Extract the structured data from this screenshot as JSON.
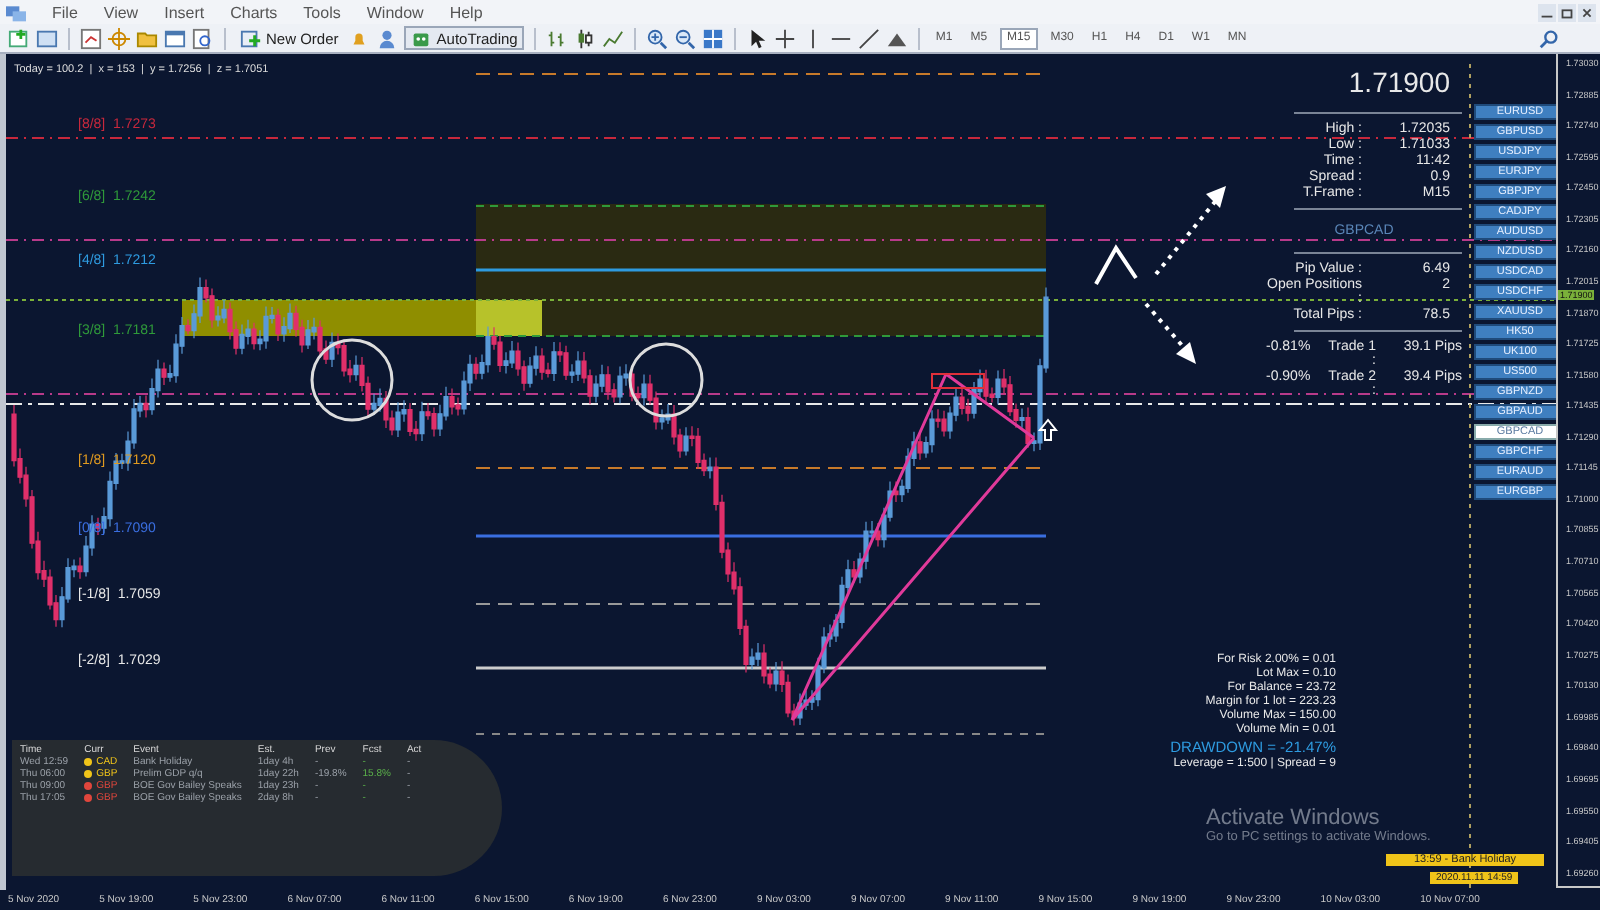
{
  "menu": [
    "File",
    "View",
    "Insert",
    "Charts",
    "Tools",
    "Window",
    "Help"
  ],
  "toolbar": {
    "new_order": "New Order",
    "auto_trading": "AutoTrading",
    "timeframes": [
      {
        "label": "M1",
        "selected": false
      },
      {
        "label": "M5",
        "selected": false
      },
      {
        "label": "M15",
        "selected": true
      },
      {
        "label": "M30",
        "selected": false
      },
      {
        "label": "H1",
        "selected": false
      },
      {
        "label": "H4",
        "selected": false
      },
      {
        "label": "D1",
        "selected": false
      },
      {
        "label": "W1",
        "selected": false
      },
      {
        "label": "MN",
        "selected": false
      }
    ]
  },
  "status": "Today = 100.2  |  x = 153  |  y = 1.7256  |  z = 1.7051",
  "levels": [
    {
      "label": "[8/8]",
      "price": "1.7273",
      "color": "#c8283c"
    },
    {
      "label": "[6/8]",
      "price": "1.7242",
      "color": "#2f9a3a"
    },
    {
      "label": "[4/8]",
      "price": "1.7212",
      "color": "#2e9be0"
    },
    {
      "label": "[3/8]",
      "price": "1.7181",
      "color": "#2f9a3a"
    },
    {
      "label": "[1/8]",
      "price": "1.7120",
      "color": "#e09a20"
    },
    {
      "label": "[0/8]",
      "price": "1.7090",
      "color": "#3a6ee0"
    },
    {
      "label": "[-1/8]",
      "price": "1.7059",
      "color": "#e8e8e8"
    },
    {
      "label": "[-2/8]",
      "price": "1.7029",
      "color": "#e8e8e8"
    }
  ],
  "info": {
    "price": "1.71900",
    "stats": [
      {
        "label": "High :",
        "value": "1.72035"
      },
      {
        "label": "Low :",
        "value": "1.71033"
      },
      {
        "label": "Time :",
        "value": "11:42"
      },
      {
        "label": "Spread :",
        "value": "0.9"
      },
      {
        "label": "T.Frame :",
        "value": "M15"
      }
    ],
    "symbol": "GBPCAD",
    "position": [
      {
        "label": "Pip Value :",
        "value": "6.49"
      },
      {
        "label": "Open Positions :",
        "value": "2"
      },
      {
        "label": "Total Pips :",
        "value": "78.5"
      }
    ],
    "trades": [
      {
        "pct": "-0.81%",
        "label": "Trade 1 :",
        "value": "39.1 Pips"
      },
      {
        "pct": "-0.90%",
        "label": "Trade 2 :",
        "value": "39.4 Pips"
      }
    ]
  },
  "symbols": [
    {
      "label": "EURUSD",
      "selected": false
    },
    {
      "label": "GBPUSD",
      "selected": false
    },
    {
      "label": "USDJPY",
      "selected": false
    },
    {
      "label": "EURJPY",
      "selected": false
    },
    {
      "label": "GBPJPY",
      "selected": false
    },
    {
      "label": "CADJPY",
      "selected": false
    },
    {
      "label": "AUDUSD",
      "selected": false
    },
    {
      "label": "NZDUSD",
      "selected": false
    },
    {
      "label": "USDCAD",
      "selected": false
    },
    {
      "label": "USDCHF",
      "selected": false
    },
    {
      "label": "XAUUSD",
      "selected": false
    },
    {
      "label": "HK50",
      "selected": false
    },
    {
      "label": "UK100",
      "selected": false
    },
    {
      "label": "US500",
      "selected": false
    },
    {
      "label": "GBPNZD",
      "selected": false
    },
    {
      "label": "GBPAUD",
      "selected": false
    },
    {
      "label": "GBPCAD",
      "selected": true
    },
    {
      "label": "GBPCHF",
      "selected": false
    },
    {
      "label": "EURAUD",
      "selected": false
    },
    {
      "label": "EURGBP",
      "selected": false
    }
  ],
  "news": {
    "columns": [
      "Time",
      "Curr",
      "Event",
      "Est.",
      "Prev",
      "Fcst",
      "Act"
    ],
    "rows": [
      {
        "time": "Wed 12:59",
        "currency": "CAD",
        "color": "#f0c419",
        "event": "Bank Holiday",
        "eta": "1day 4h",
        "prev": "-",
        "fcst": "-",
        "act": "-"
      },
      {
        "time": "Thu 06:00",
        "currency": "GBP",
        "color": "#f0c419",
        "event": "Prelim GDP q/q",
        "eta": "1day 22h",
        "prev": "-19.8%",
        "fcst": "15.8%",
        "act": "-"
      },
      {
        "time": "Thu 09:00",
        "currency": "GBP",
        "color": "#e0463c",
        "event": "BOE Gov Bailey Speaks",
        "eta": "1day 23h",
        "prev": "-",
        "fcst": "-",
        "act": "-"
      },
      {
        "time": "Thu 17:05",
        "currency": "GBP",
        "color": "#e0463c",
        "event": "BOE Gov Bailey Speaks",
        "eta": "2day 8h",
        "prev": "-",
        "fcst": "-",
        "act": "-"
      }
    ]
  },
  "risk": [
    {
      "kind": "plain",
      "text": "For Risk 2.00% = 0.01"
    },
    {
      "kind": "plain",
      "text": "Lot Max = 0.10"
    },
    {
      "kind": "plain",
      "text": "For Balance = 23.72"
    },
    {
      "kind": "plain",
      "text": "Margin for 1 lot = 223.23"
    },
    {
      "kind": "plain",
      "text": "Volume Max = 150.00"
    },
    {
      "kind": "plain",
      "text": "Volume Min = 0.01"
    },
    {
      "kind": "alert",
      "text": "DRAWDOWN = -21.47%"
    },
    {
      "kind": "plain",
      "text": "Leverage = 1:500 | Spread = 9"
    }
  ],
  "event_tag": "13:59 - Bank Holiday",
  "time_tag": "2020.11.11 14:59",
  "current_price_tag": "1.71900",
  "price_axis": [
    "1.73030",
    "1.72885",
    "1.72740",
    "1.72595",
    "1.72450",
    "1.72305",
    "1.72160",
    "1.72015",
    "1.71870",
    "1.71725",
    "1.71580",
    "1.71435",
    "1.71290",
    "1.71145",
    "1.71000",
    "1.70855",
    "1.70710",
    "1.70565",
    "1.70420",
    "1.70275",
    "1.70130",
    "1.69985",
    "1.69840",
    "1.69695",
    "1.69550",
    "1.69405",
    "1.69260"
  ],
  "time_axis": [
    "5 Nov 2020",
    "5 Nov 19:00",
    "5 Nov 23:00",
    "6 Nov 07:00",
    "6 Nov 11:00",
    "6 Nov 15:00",
    "6 Nov 19:00",
    "6 Nov 23:00",
    "9 Nov 03:00",
    "9 Nov 07:00",
    "9 Nov 11:00",
    "9 Nov 15:00",
    "9 Nov 19:00",
    "9 Nov 23:00",
    "10 Nov 03:00",
    "10 Nov 07:00"
  ],
  "os_notice": {
    "title": "Activate Windows",
    "subtitle": "Go to PC settings to activate Windows."
  }
}
